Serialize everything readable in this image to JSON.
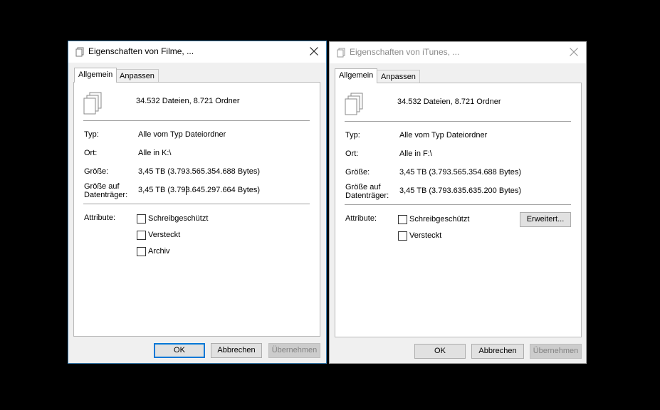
{
  "dialogs": [
    {
      "title": "Eigenschaften von Filme, ...",
      "tabs": [
        "Allgemein",
        "Anpassen"
      ],
      "summary": "34.532 Dateien, 8.721 Ordner",
      "type_label": "Typ:",
      "type_value": "Alle vom Typ Dateiordner",
      "location_label": "Ort:",
      "location_value": "Alle in K:\\",
      "size_label": "Größe:",
      "size_value": "3,45 TB (3.793.565.354.688 Bytes)",
      "disk_size_label_1": "Größe auf",
      "disk_size_label_2": "Datenträger:",
      "disk_size_value": "3,45 TB (3.793.645.297.664 Bytes)",
      "attributes_label": "Attribute:",
      "checkboxes": [
        "Schreibgeschützt",
        "Versteckt",
        "Archiv"
      ],
      "buttons": {
        "ok": "OK",
        "cancel": "Abbrechen",
        "apply": "Übernehmen"
      }
    },
    {
      "title": "Eigenschaften von iTunes, ...",
      "tabs": [
        "Allgemein",
        "Anpassen"
      ],
      "summary": "34.532 Dateien, 8.721 Ordner",
      "type_label": "Typ:",
      "type_value": "Alle vom Typ Dateiordner",
      "location_label": "Ort:",
      "location_value": "Alle in F:\\",
      "size_label": "Größe:",
      "size_value": "3,45 TB (3.793.565.354.688 Bytes)",
      "disk_size_label_1": "Größe auf",
      "disk_size_label_2": "Datenträger:",
      "disk_size_value": "3,45 TB (3.793.635.635.200 Bytes)",
      "attributes_label": "Attribute:",
      "checkboxes": [
        "Schreibgeschützt",
        "Versteckt"
      ],
      "advanced_button": "Erweitert...",
      "buttons": {
        "ok": "OK",
        "cancel": "Abbrechen",
        "apply": "Übernehmen"
      }
    }
  ]
}
